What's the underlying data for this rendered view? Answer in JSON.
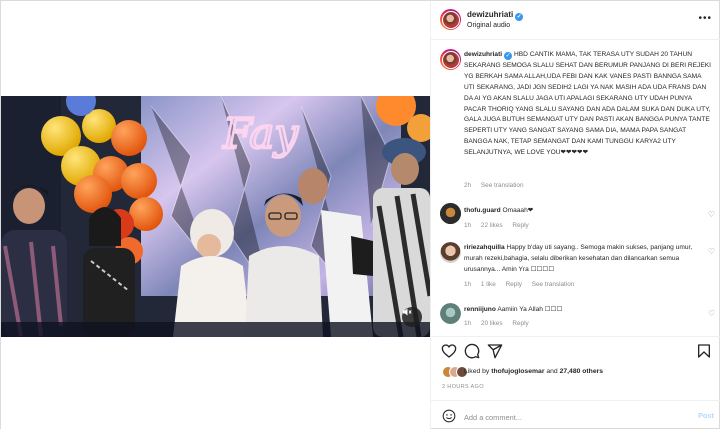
{
  "post": {
    "author": "dewizuhriati",
    "audio": "Original audio"
  },
  "caption": {
    "username": "dewizuhriati",
    "text": "HBD CANTIK MAMA, TAK TERASA UTY SUDAH 20 TAHUN SEKARANG SEMOGA SLALU SEHAT DAN BERUMUR PANJANG DI BERI REJEKI YG BERKAH SAMA ALLAH,UDA FEBI DAN KAK VANES PASTI BANNGA SAMA UTI SEKARANG, JADI JGN SEDIH2 LAGI YA NAK MASIH ADA UDA FRANS DAN DA AI YG AKAN SLALU JAGA UTI APALAGI SEKARANG UTY UDAH PUNYA PACAR THORIQ YANG SLALU SAYANG DAN ADA DALAM SUKA DAN DUKA UTY, GALA JUGA BUTUH SEMANGAT UTY DAN PASTI AKAN BANGGA PUNYA TANTE SEPERTI UTY YANG SANGAT SAYANG SAMA DIA, MAMA PAPA SANGAT BANGGA NAK, TETAP SEMANGAT DAN KAMI TUNGGU KARYA2 UTY SELANJUTNYA, WE LOVE YOU❤❤❤❤❤",
    "time": "2h",
    "see_translation": "See translation"
  },
  "comments": [
    {
      "username": "thofu.guard",
      "text": "Omaaah❤",
      "time": "1h",
      "likes": "22 likes",
      "reply": "Reply",
      "see_translation": ""
    },
    {
      "username": "ririezahquilla",
      "text": "Happy b'day uti sayang.. Semoga makin sukses, panjang umur, murah rezeki,bahagia, selalu diberikan kesehatan dan dilancarkan semua urusannya... Amin Yra ☐☐☐☐",
      "time": "1h",
      "likes": "1 like",
      "reply": "Reply",
      "see_translation": "See translation"
    },
    {
      "username": "renniijuno",
      "text": "Aamiin Ya Allah ☐☐☐",
      "time": "1h",
      "likes": "20 likes",
      "reply": "Reply",
      "see_translation": ""
    }
  ],
  "likes_summary": {
    "prefix": "Liked by ",
    "first_user": "thofujoglosemar",
    "middle": " and ",
    "count": "27,480 others"
  },
  "time_ago": "2 HOURS AGO",
  "add_comment": {
    "placeholder": "Add a comment...",
    "post_label": "Post"
  },
  "colors": {
    "verified": "#3897f0",
    "heart": "#ed4956",
    "post_disabled": "#b3dbff",
    "muted": "#8e8e8e"
  },
  "icons": {
    "actions": [
      "heart-icon",
      "comment-icon",
      "share-icon",
      "bookmark-icon"
    ],
    "video": "mute-icon",
    "header": "more-options-icon",
    "input": "emoji-icon"
  }
}
